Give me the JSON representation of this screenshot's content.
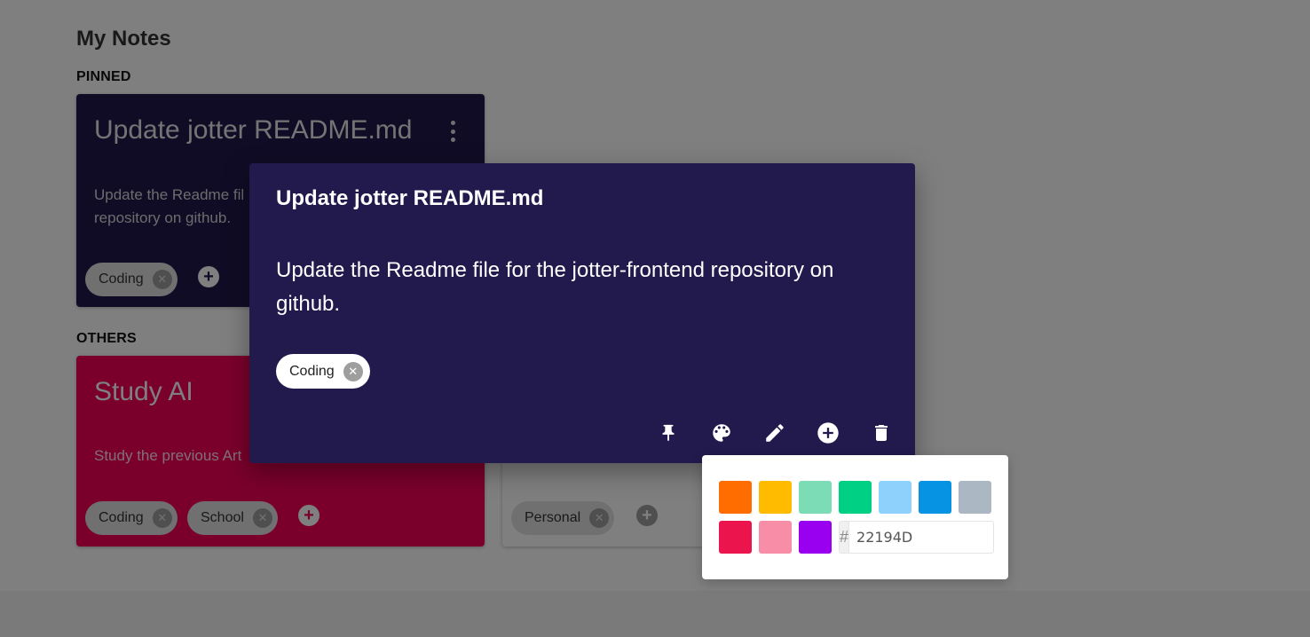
{
  "page": {
    "title": "My Notes"
  },
  "sections": {
    "pinned": "PINNED",
    "others": "OTHERS"
  },
  "notes": [
    {
      "title": "Update jotter README.md",
      "body": "Update the Readme file for the jotter-frontend repository on github.",
      "tags": [
        "Coding"
      ],
      "color": "#22194D"
    },
    {
      "title": "Study AI",
      "body": "Study the previous Artificial Intelligence notes.",
      "tags": [
        "Coding",
        "School"
      ],
      "color": "#F50057"
    },
    {
      "title": "",
      "body": "",
      "tags": [
        "Personal"
      ],
      "color": "#ffffff"
    }
  ],
  "card_texts": {
    "pinned_body_line1": "Update the Readme fil",
    "pinned_body_line2": "repository on github.",
    "study_body": "Study the previous Art"
  },
  "modal": {
    "title": "Update jotter README.md",
    "body": "Update the Readme file for the jotter-frontend repository on github.",
    "tag": "Coding",
    "background": "#22194D",
    "actions": [
      "pin-icon",
      "palette-icon",
      "edit-icon",
      "add-circle-icon",
      "delete-icon"
    ]
  },
  "palette": {
    "swatches": [
      "#FF6D00",
      "#FFBB00",
      "#7BDCB5",
      "#00D084",
      "#8ED1FC",
      "#0693E3",
      "#ABB8C3",
      "#EB144C",
      "#F78DA7",
      "#9900EF"
    ],
    "hex_prefix": "#",
    "hex_value": "22194D"
  },
  "icons": {
    "tag_remove": "close-circle-icon",
    "tag_add": "add-circle-icon",
    "menu": "more-vert-icon"
  }
}
